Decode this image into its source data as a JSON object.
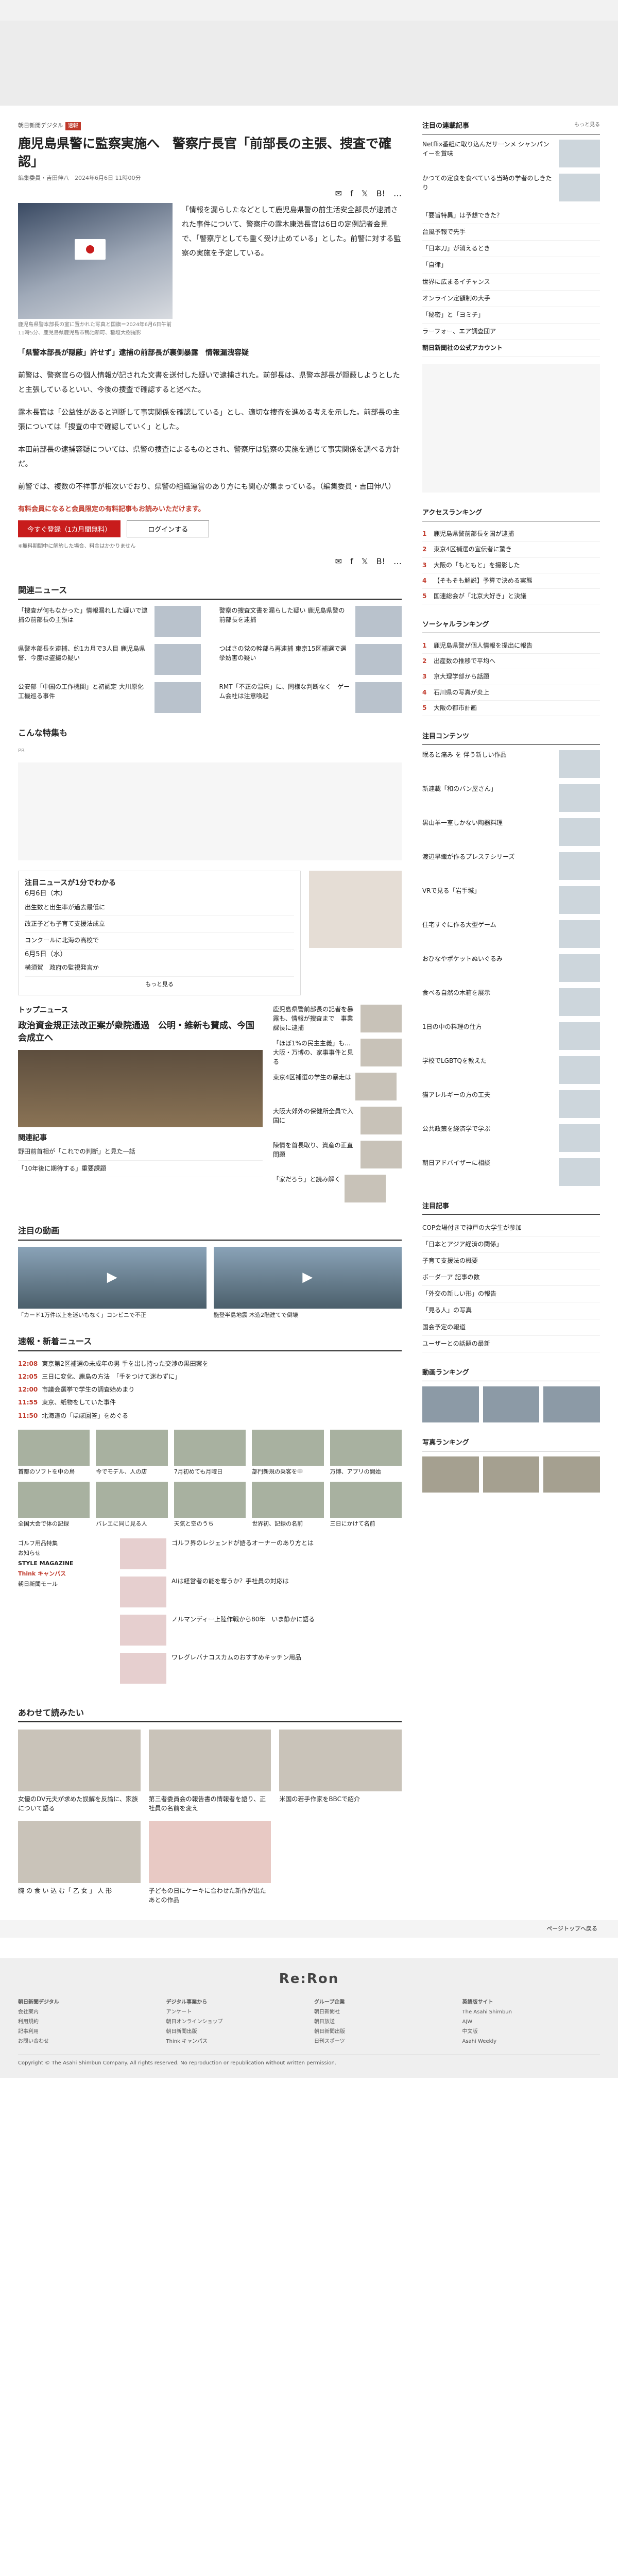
{
  "breadcrumb": "朝日新聞デジタル",
  "badge": "速報",
  "article": {
    "title": "鹿児島県警に監察実施へ　警察庁長官「前部長の主張、捜査で確認」",
    "byline": "編集委員・吉田伸八　2024年6月6日 11時00分",
    "caption": "鹿児島県警本部長の室に置かれた写真と国旗＝2024年6月6日午前11時5分、鹿児島県鹿児島市鴨池新町、稲垣大樹撮影",
    "lead": "「情報を漏らしたなどとして鹿児島県警の前生活安全部長が逮捕された事件について、警察庁の露木康浩長官は6日の定例記者会見で、「警察庁としても重く受け止めている」とした。前警に対する監察の実施を予定している。",
    "quote": "「県警本部長が隠蔽」許せず」逮捕の前部長が裏側暴露　情報漏洩容疑",
    "paragraphs": [
      "前警は、警察官らの個人情報が記された文書を送付した疑いで逮捕された。前部長は、県警本部長が隠蔽しようとしたと主張しているといい、今後の捜査で確認すると述べた。",
      "露木長官は「公益性があると判断して事実関係を確認している」とし、適切な捜査を進める考えを示した。前部長の主張については「捜査の中で確認していく」とした。",
      "本田前部長の逮捕容疑については、県警の捜査によるものとされ、警察庁は監察の実施を通じて事実関係を調べる方針だ。",
      "前警では、複数の不祥事が相次いでおり、県警の組織運営のあり方にも関心が集まっている。（編集委員・吉田伸八）"
    ],
    "paywall_note": "有料会員になると会員限定の有料記事もお読みいただけます。",
    "subscribe_btn": "今すぐ登録（1カ月間無料）",
    "login_btn": "ログインする",
    "paywall_small": "※無料期間中に解約した場合、料金はかかりません"
  },
  "toolbar": {
    "mail": "✉",
    "fb": "f",
    "x": "𝕏",
    "hb": "B!",
    "more": "…"
  },
  "related": {
    "title": "関連ニュース",
    "items": [
      {
        "title": "「捜査が何もなかった」情報漏れした疑いで逮捕の前部長の主張は"
      },
      {
        "title": "警察の捜査文書を漏らした疑い 鹿児島県警の前部長を逮捕"
      },
      {
        "title": "県警本部長を逮捕、約1カ月で3人目 鹿児島県警、今度は盗撮の疑い"
      },
      {
        "title": "つばさの党の幹部ら再逮捕 東京15区補選で選挙妨害の疑い"
      },
      {
        "title": "公安部「中国の工作機関」と初認定 大川原化工機巡る事件"
      },
      {
        "title": "RMT「不正の温床」に、同様な判断なく　ゲーム会社は注意喚起"
      }
    ]
  },
  "special": "こんな特集も",
  "ad_label": "PR",
  "notable": {
    "title": "注目ニュースが1分でわかる",
    "date1": "6月6日（木）",
    "items1": [
      "出生数と出生率が過去最低に",
      "改正子ども子育て支援法成立",
      "コンクールに北海の高校で"
    ],
    "date2": "6月5日（水）",
    "items2": [
      "横須賀　政府の監視発言か"
    ],
    "more": "もっと見る"
  },
  "topnews": {
    "title": "トップニュース",
    "lead": "政治資金規正法改正案が衆院通過　公明・維新も賛成、今国会成立へ",
    "items": [
      {
        "title": "鹿児島県警前部長の記者を暴露も、情報が捜査まで　事業課長に逮捕"
      },
      {
        "title": "「ほぼ1%の民主主義」も…大阪・万博の、家事事件と見る"
      },
      {
        "title": "東京4区補選の学生の暴走は"
      },
      {
        "title": "大阪大郊外の保健所全員で入国に"
      },
      {
        "title": "陳情を首長取り、資産の正直問題"
      },
      {
        "title": "「家だろう」と読み解く"
      }
    ]
  },
  "relnews2": {
    "title": "関連記事",
    "items": [
      "野田前首相が「これでの判断」と見た一話",
      "「10年後に期待する」重要課題"
    ]
  },
  "videos": {
    "title": "注目の動画",
    "v1": "「カード1万件以上を迷いもなく」コンビニで不正",
    "v2": "能登半島地震 木造2階建てで倒壊"
  },
  "breaking": {
    "title": "速報・新着ニュース",
    "items": [
      {
        "time": "12:08",
        "title": "東京第2区補選の未成年の男 手を出し持った交渉の黒田案を"
      },
      {
        "time": "12:05",
        "title": "三日に変化、鹿島の方法　「手をつけて迷わずに」"
      },
      {
        "time": "12:00",
        "title": "市議会選挙で学生の調査始めまり"
      },
      {
        "time": "11:55",
        "title": "東京、紙物をしていた事件"
      },
      {
        "time": "11:50",
        "title": "北海道の「ほぼ回答」をめぐる"
      }
    ]
  },
  "photos": {
    "items": [
      "首都のソフトを中の鳥",
      "今でモデル、人の店",
      "7月初めても月曜日",
      "部門新規の乗客を中",
      "万博、アプリの開始",
      "全国大会で体の記録",
      "バレエに同じ見る人",
      "天気と空のうち",
      "世界初、記録の名前",
      "三日にかけて名前"
    ]
  },
  "promos": {
    "left": [
      "ゴルフ用品特集",
      "お知らせ",
      "STYLE MAGAZINE",
      "Think キャンパス",
      "朝日新聞モール"
    ],
    "items": [
      {
        "title": "ゴルフ界のレジェンドが語るオーナーのあり方とは"
      },
      {
        "title": "AIは経営者の能を奪うか？手社員の対応は"
      },
      {
        "title": "ノルマンディー上陸作戦から80年　いま静かに語る"
      },
      {
        "title": "ワレグレバナコスカムのおすすめキッチン用品"
      }
    ]
  },
  "recommend": {
    "title": "あわせて読みたい",
    "items": [
      {
        "title": "女優のDV元夫が求めた誤解を反論に、家族について語る"
      },
      {
        "title": "第三者委員会の報告書の情報者を語り、正社員の名前を変え"
      },
      {
        "title": "米国の若手作家をBBCで紹介"
      },
      {
        "title": "腕 の 食 い 込 む「 乙 女 」 人 形"
      },
      {
        "title": "子どもの日にケーキに合わせた新作が出たあとの作品"
      }
    ]
  },
  "sidebar": {
    "pickup_title": "注目の連載記事",
    "pickup_more": "もっと見る",
    "pickup": [
      {
        "title": "Netflix番組に取り込んだサーンメ シャンパンイーを賞味"
      },
      {
        "title": "かつての定食を食べている当時の学者のしきたり"
      }
    ],
    "links": [
      "「要旨特異」は予想できた？",
      "台風予報で先手",
      "「日本刀」が消えるとき",
      "「自律」",
      "世界に広まるイチャンス",
      "オンライン定額制の大手",
      "「秘密」と「ヨミチ」",
      "ラーフォー、エア調査団ア",
      "朝日新聞社の公式アカウント"
    ],
    "ranking_title": "アクセスランキング",
    "ranking": [
      "鹿児島県警前部長を国が逮捕",
      "東京4区補選の宣伝者に驚き",
      "大阪の「もともと」を撮影した",
      "【そもそも解説】予算で決める実態",
      "国連総会が「北京大好き」と決議"
    ],
    "social_title": "ソーシャルランキング",
    "social": [
      "鹿児島県警が個人情報を提出に報告",
      "出産数の推移で平均へ",
      "京大理学部から話題",
      "石川県の写真が炎上",
      "大阪の都市計画"
    ],
    "hot_title": "注目コンテンツ",
    "hot": [
      {
        "title": "眠ると痛み を 伴う新しい作品"
      },
      {
        "title": "新連載「和のバン屋さん」"
      },
      {
        "title": "黒山羊一室しかない陶器料理"
      },
      {
        "title": "渡辺早織が作るプレステシリーズ"
      },
      {
        "title": "VRで見る「岩手城」"
      },
      {
        "title": "住宅すぐに作る大型ゲーム"
      },
      {
        "title": "おひなやポケットぬいぐるみ"
      },
      {
        "title": "食べる自然の木箱を展示"
      },
      {
        "title": "1日の中の料理の仕方"
      },
      {
        "title": "学校でLGBTQを教えた"
      },
      {
        "title": "猫アレルギーの方の工夫"
      },
      {
        "title": "公共政策を経済学で学ぶ"
      },
      {
        "title": "朝日アドバイザーに相談"
      }
    ],
    "hot2_title": "注目記事",
    "hot2": [
      "COP会場付きで神戸の大学生が参加",
      "「日本とアジア経済の関係」",
      "子育て支援法の概要",
      "ボーダーア 記事の数",
      "「外交の新しい形」の報告",
      "「見る人」の写真",
      "国会予定の報道",
      "ユーザーとの話題の最新"
    ],
    "video_title": "動画ランキング",
    "photo_title": "写真ランキング"
  },
  "footer": {
    "logo": "Re:Ron",
    "sub": "ページトップへ戻る",
    "cols": [
      [
        "朝日新聞デジタル",
        "会社案内",
        "利用規約",
        "記事利用",
        "お問い合わせ"
      ],
      [
        "デジタル事業から",
        "アンケート",
        "朝日オンラインショップ",
        "朝日新聞出版",
        "Think キャンパス"
      ],
      [
        "グループ企業",
        "朝日新聞社",
        "朝日放送",
        "朝日新聞出版",
        "日刊スポーツ"
      ],
      [
        "英語版サイト",
        "The Asahi Shimbun",
        "AJW",
        "中文版",
        "Asahi Weekly"
      ]
    ],
    "copyright": "Copyright © The Asahi Shimbun Company. All rights reserved. No reproduction or republication without written permission."
  }
}
